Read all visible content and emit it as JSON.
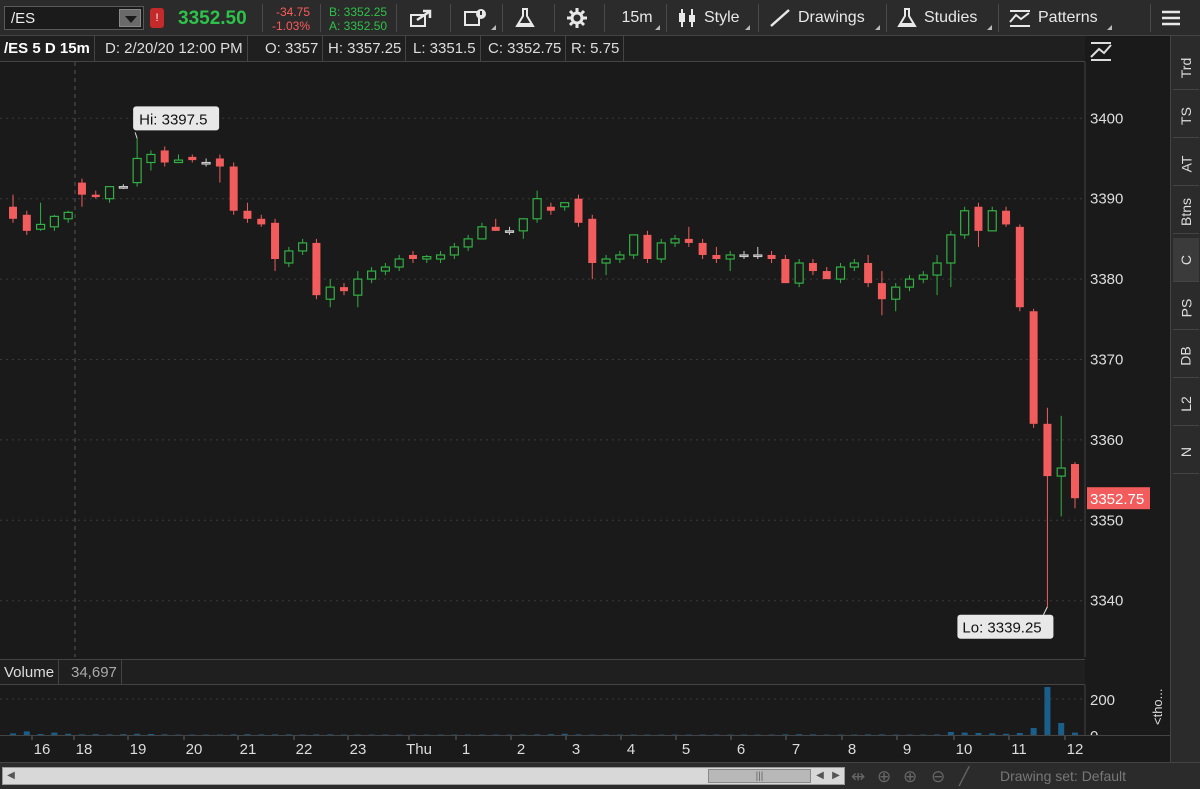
{
  "toolbar": {
    "symbol": "/ES",
    "link_badge": "!",
    "last_price": "3352.50",
    "net_change": "-34.75",
    "net_change_pct": "-1.03%",
    "bid": "B: 3352.25",
    "ask": "A: 3352.50",
    "timeframe": "15m",
    "style_label": "Style",
    "drawings_label": "Drawings",
    "studies_label": "Studies",
    "patterns_label": "Patterns"
  },
  "chart_header": {
    "description": "/ES 5 D 15m",
    "date": "D: 2/20/20 12:00 PM",
    "open": "O: 3357",
    "high": "H: 3357.25",
    "low": "L: 3351.5",
    "close": "C: 3352.75",
    "range": "R: 5.75"
  },
  "side_tabs": [
    "Trd",
    "TS",
    "AT",
    "Btns",
    "C",
    "PS",
    "DB",
    "L2",
    "N"
  ],
  "volume_header": {
    "label": "Volume",
    "value": "34,697"
  },
  "status_bar": {
    "drawing_set": "Drawing set: Default",
    "scroll_thumb": "|||"
  },
  "colors": {
    "up": "#33b044",
    "down": "#f25c5c",
    "volume": "#1a5f8c",
    "price_tag": "#f25c5c"
  },
  "chart_data": {
    "type": "candlestick",
    "y_axis_ticks": [
      3340,
      3350,
      3360,
      3370,
      3380,
      3390,
      3400
    ],
    "ylim": [
      3333,
      3407
    ],
    "high_label": "Hi: 3397.5",
    "low_label": "Lo: 3339.25",
    "last_price_label": "3352.75",
    "x_tick_labels": [
      "16",
      "18",
      "19",
      "20",
      "21",
      "22",
      "23",
      "Thu",
      "1",
      "2",
      "3",
      "4",
      "5",
      "6",
      "7",
      "8",
      "9",
      "10",
      "11",
      "12"
    ],
    "volume_axis_ticks": [
      "200",
      "0"
    ],
    "volume_axis_note": "<tho...",
    "candles": [
      {
        "o": 3389.0,
        "h": 3390.5,
        "l": 3387.0,
        "c": 3387.5
      },
      {
        "o": 3388.0,
        "h": 3388.5,
        "l": 3385.5,
        "c": 3386.0
      },
      {
        "o": 3386.2,
        "h": 3389.5,
        "l": 3386.0,
        "c": 3386.8
      },
      {
        "o": 3386.5,
        "h": 3388.0,
        "l": 3386.0,
        "c": 3387.8
      },
      {
        "o": 3387.5,
        "h": 3388.5,
        "l": 3387.0,
        "c": 3388.3
      },
      {
        "o": 3392.0,
        "h": 3392.5,
        "l": 3389.0,
        "c": 3390.5
      },
      {
        "o": 3390.5,
        "h": 3391.0,
        "l": 3390.0,
        "c": 3390.2
      },
      {
        "o": 3390.0,
        "h": 3391.5,
        "l": 3389.5,
        "c": 3391.5
      },
      {
        "o": 3391.5,
        "h": 3391.8,
        "l": 3391.2,
        "c": 3391.5
      },
      {
        "o": 3392.0,
        "h": 3397.5,
        "l": 3391.5,
        "c": 3395.0
      },
      {
        "o": 3394.5,
        "h": 3396.0,
        "l": 3393.5,
        "c": 3395.5
      },
      {
        "o": 3396.0,
        "h": 3396.5,
        "l": 3394.0,
        "c": 3394.5
      },
      {
        "o": 3394.5,
        "h": 3395.5,
        "l": 3394.5,
        "c": 3394.8
      },
      {
        "o": 3395.2,
        "h": 3395.5,
        "l": 3394.5,
        "c": 3394.8
      },
      {
        "o": 3394.5,
        "h": 3395.0,
        "l": 3394.0,
        "c": 3394.5
      },
      {
        "o": 3395.0,
        "h": 3395.5,
        "l": 3392.0,
        "c": 3394.0
      },
      {
        "o": 3394.0,
        "h": 3394.5,
        "l": 3388.0,
        "c": 3388.5
      },
      {
        "o": 3388.5,
        "h": 3389.5,
        "l": 3387.0,
        "c": 3387.5
      },
      {
        "o": 3387.5,
        "h": 3388.0,
        "l": 3386.5,
        "c": 3386.8
      },
      {
        "o": 3387.0,
        "h": 3387.5,
        "l": 3381.0,
        "c": 3382.5
      },
      {
        "o": 3382.0,
        "h": 3384.0,
        "l": 3381.5,
        "c": 3383.5
      },
      {
        "o": 3383.5,
        "h": 3385.0,
        "l": 3383.0,
        "c": 3384.5
      },
      {
        "o": 3384.5,
        "h": 3385.0,
        "l": 3377.5,
        "c": 3378.0
      },
      {
        "o": 3377.5,
        "h": 3380.0,
        "l": 3376.5,
        "c": 3379.0
      },
      {
        "o": 3379.0,
        "h": 3379.5,
        "l": 3378.0,
        "c": 3378.5
      },
      {
        "o": 3378.0,
        "h": 3381.0,
        "l": 3376.5,
        "c": 3380.0
      },
      {
        "o": 3380.0,
        "h": 3381.5,
        "l": 3379.5,
        "c": 3381.0
      },
      {
        "o": 3381.0,
        "h": 3382.0,
        "l": 3380.5,
        "c": 3381.5
      },
      {
        "o": 3381.5,
        "h": 3383.0,
        "l": 3381.0,
        "c": 3382.5
      },
      {
        "o": 3383.0,
        "h": 3383.5,
        "l": 3382.0,
        "c": 3382.5
      },
      {
        "o": 3382.5,
        "h": 3383.0,
        "l": 3382.0,
        "c": 3382.8
      },
      {
        "o": 3382.5,
        "h": 3383.5,
        "l": 3382.0,
        "c": 3383.0
      },
      {
        "o": 3383.0,
        "h": 3384.5,
        "l": 3382.5,
        "c": 3384.0
      },
      {
        "o": 3384.0,
        "h": 3385.5,
        "l": 3383.5,
        "c": 3385.0
      },
      {
        "o": 3385.0,
        "h": 3387.0,
        "l": 3385.0,
        "c": 3386.5
      },
      {
        "o": 3386.5,
        "h": 3387.5,
        "l": 3386.0,
        "c": 3386.0
      },
      {
        "o": 3386.0,
        "h": 3386.5,
        "l": 3385.5,
        "c": 3386.0
      },
      {
        "o": 3386.0,
        "h": 3387.5,
        "l": 3385.0,
        "c": 3387.5
      },
      {
        "o": 3387.5,
        "h": 3391.0,
        "l": 3387.0,
        "c": 3390.0
      },
      {
        "o": 3389.0,
        "h": 3389.5,
        "l": 3388.0,
        "c": 3388.5
      },
      {
        "o": 3389.0,
        "h": 3389.5,
        "l": 3388.5,
        "c": 3389.5
      },
      {
        "o": 3390.0,
        "h": 3390.5,
        "l": 3386.5,
        "c": 3387.0
      },
      {
        "o": 3387.5,
        "h": 3388.0,
        "l": 3380.0,
        "c": 3382.0
      },
      {
        "o": 3382.0,
        "h": 3383.0,
        "l": 3380.5,
        "c": 3382.5
      },
      {
        "o": 3382.5,
        "h": 3383.5,
        "l": 3382.0,
        "c": 3383.0
      },
      {
        "o": 3383.0,
        "h": 3385.5,
        "l": 3382.5,
        "c": 3385.5
      },
      {
        "o": 3385.5,
        "h": 3386.0,
        "l": 3382.0,
        "c": 3382.5
      },
      {
        "o": 3382.5,
        "h": 3385.0,
        "l": 3382.0,
        "c": 3384.5
      },
      {
        "o": 3384.5,
        "h": 3385.5,
        "l": 3384.0,
        "c": 3385.0
      },
      {
        "o": 3385.0,
        "h": 3386.5,
        "l": 3384.0,
        "c": 3384.5
      },
      {
        "o": 3384.5,
        "h": 3385.0,
        "l": 3382.5,
        "c": 3383.0
      },
      {
        "o": 3383.0,
        "h": 3384.0,
        "l": 3382.0,
        "c": 3382.5
      },
      {
        "o": 3382.5,
        "h": 3383.5,
        "l": 3381.0,
        "c": 3383.0
      },
      {
        "o": 3383.0,
        "h": 3383.5,
        "l": 3382.5,
        "c": 3383.0
      },
      {
        "o": 3383.0,
        "h": 3384.0,
        "l": 3382.5,
        "c": 3383.0
      },
      {
        "o": 3383.0,
        "h": 3383.5,
        "l": 3382.0,
        "c": 3382.5
      },
      {
        "o": 3382.5,
        "h": 3383.0,
        "l": 3379.5,
        "c": 3379.5
      },
      {
        "o": 3379.5,
        "h": 3382.5,
        "l": 3379.0,
        "c": 3382.0
      },
      {
        "o": 3382.0,
        "h": 3382.5,
        "l": 3380.5,
        "c": 3381.0
      },
      {
        "o": 3381.0,
        "h": 3381.5,
        "l": 3380.0,
        "c": 3380.0
      },
      {
        "o": 3380.0,
        "h": 3382.0,
        "l": 3379.5,
        "c": 3381.5
      },
      {
        "o": 3381.5,
        "h": 3382.5,
        "l": 3381.0,
        "c": 3382.0
      },
      {
        "o": 3382.0,
        "h": 3383.0,
        "l": 3379.0,
        "c": 3379.5
      },
      {
        "o": 3379.5,
        "h": 3381.0,
        "l": 3375.5,
        "c": 3377.5
      },
      {
        "o": 3377.5,
        "h": 3379.5,
        "l": 3376.0,
        "c": 3379.0
      },
      {
        "o": 3379.0,
        "h": 3380.5,
        "l": 3378.5,
        "c": 3380.0
      },
      {
        "o": 3380.0,
        "h": 3381.0,
        "l": 3379.5,
        "c": 3380.5
      },
      {
        "o": 3380.5,
        "h": 3383.0,
        "l": 3378.0,
        "c": 3382.0
      },
      {
        "o": 3382.0,
        "h": 3386.0,
        "l": 3379.0,
        "c": 3385.5
      },
      {
        "o": 3385.5,
        "h": 3389.0,
        "l": 3385.0,
        "c": 3388.5
      },
      {
        "o": 3389.0,
        "h": 3389.5,
        "l": 3384.0,
        "c": 3386.0
      },
      {
        "o": 3386.0,
        "h": 3389.0,
        "l": 3386.0,
        "c": 3388.5
      },
      {
        "o": 3388.5,
        "h": 3389.0,
        "l": 3386.5,
        "c": 3386.8
      },
      {
        "o": 3386.5,
        "h": 3386.8,
        "l": 3376.0,
        "c": 3376.5
      },
      {
        "o": 3376.0,
        "h": 3376.3,
        "l": 3361.5,
        "c": 3362.0
      },
      {
        "o": 3362.0,
        "h": 3364.0,
        "l": 3339.25,
        "c": 3355.5
      },
      {
        "o": 3355.5,
        "h": 3363.0,
        "l": 3350.5,
        "c": 3356.5
      },
      {
        "o": 3357.0,
        "h": 3357.25,
        "l": 3351.5,
        "c": 3352.75
      }
    ],
    "volume": [
      8,
      18,
      5,
      12,
      6,
      3,
      4,
      3,
      4,
      6,
      5,
      3,
      2,
      2,
      2,
      2,
      3,
      4,
      3,
      3,
      3,
      2,
      3,
      3,
      2,
      2,
      2,
      2,
      2,
      2,
      2,
      2,
      2,
      2,
      2,
      2,
      2,
      2,
      3,
      4,
      6,
      3,
      2,
      2,
      2,
      2,
      2,
      2,
      2,
      2,
      2,
      2,
      2,
      2,
      2,
      2,
      3,
      4,
      3,
      2,
      2,
      2,
      3,
      3,
      2,
      2,
      2,
      3,
      15,
      12,
      10,
      8,
      6,
      10,
      35,
      240,
      60,
      12
    ],
    "volume_max": 240
  }
}
